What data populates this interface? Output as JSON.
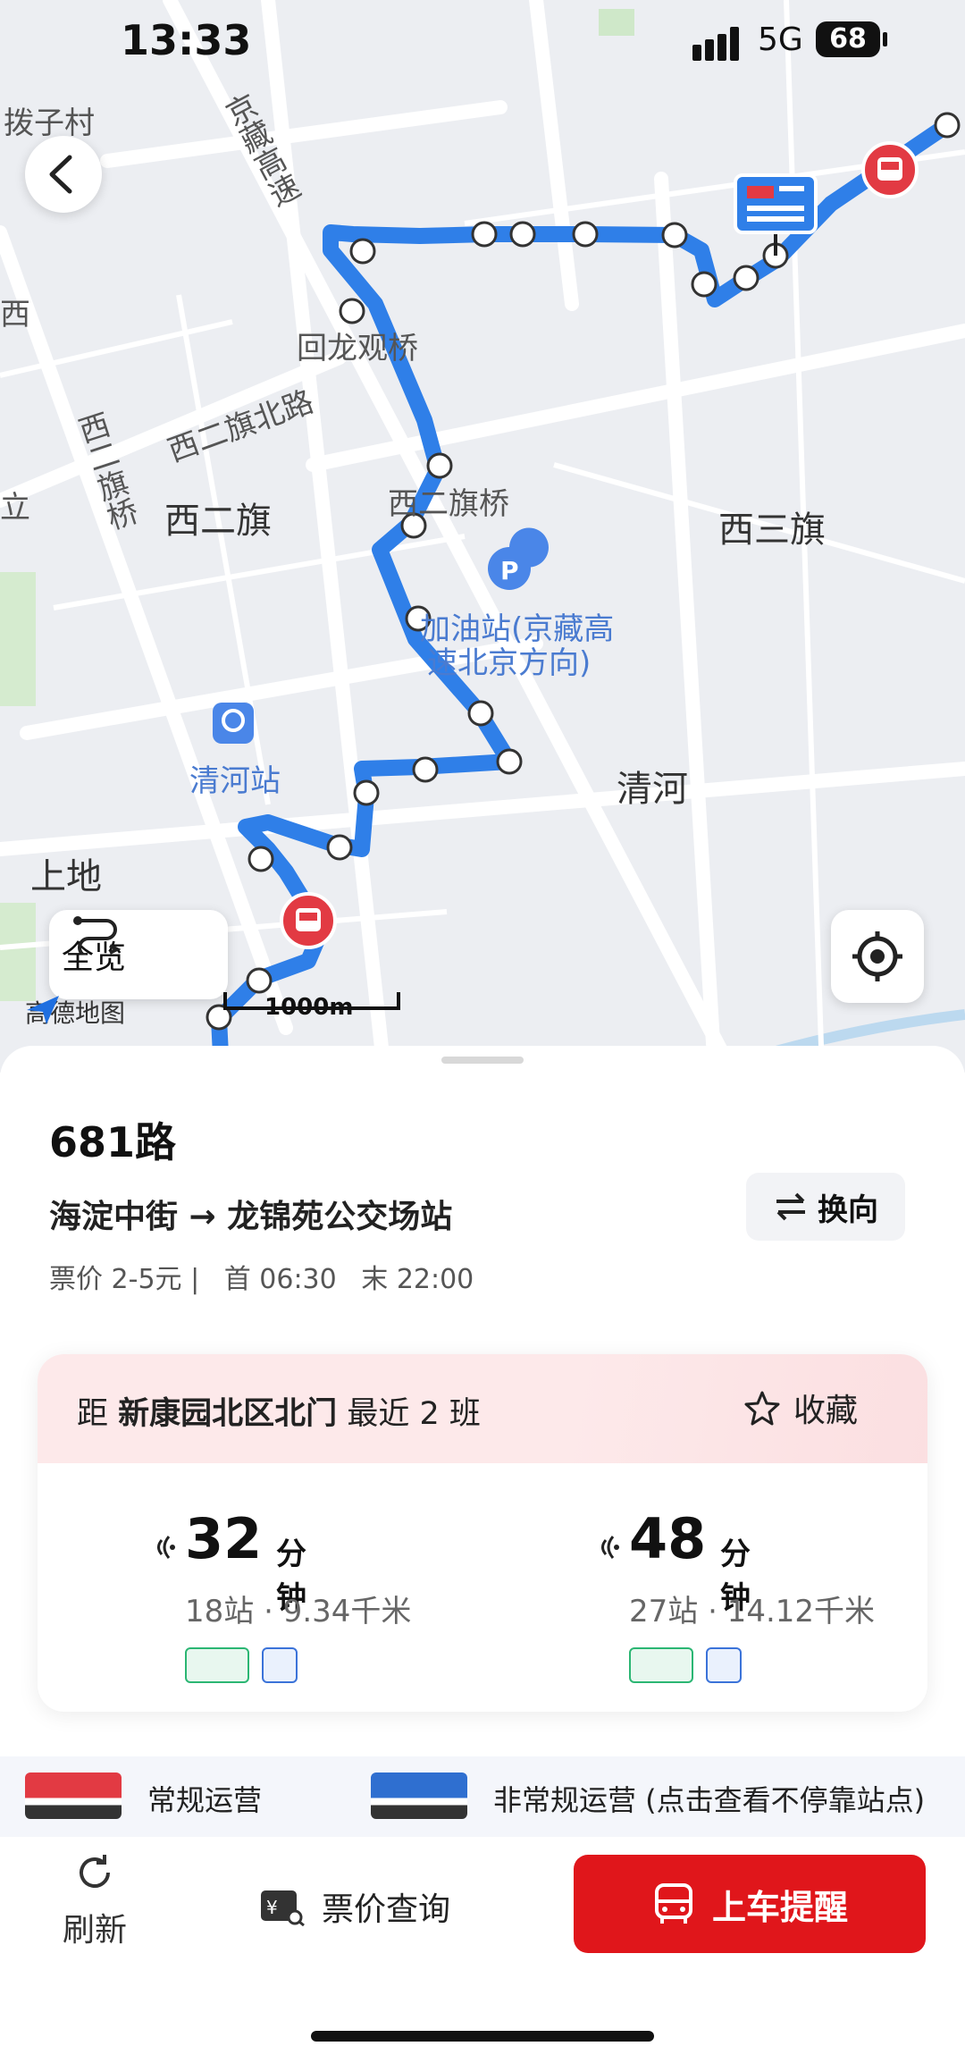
{
  "status_bar": {
    "time": "13:33",
    "network": "5G",
    "battery": "68"
  },
  "map": {
    "labels": {
      "village": "拨子村",
      "expressway": "京藏高速",
      "huilongguan_bridge": "回龙观桥",
      "xierqi_north_road": "西二旗北路",
      "xierqi_bridge": "西二旗桥",
      "xierqi_bridge_2": "西二旗桥",
      "xierqi": "西二旗",
      "xisanqi": "西三旗",
      "gas_station_1": "加油站(京藏高",
      "gas_station_2": "速北京方向)",
      "qinghe_station": "清河站",
      "qinghe": "清河",
      "shangdi": "上地",
      "xi_prefix": "西",
      "li": "立"
    },
    "overview_label": "全览",
    "scale_label": "1000m",
    "logo_text": "高德地图",
    "route_color": "#2f7fe8"
  },
  "route": {
    "name": "681路",
    "ends": "海淀中街 → 龙锦苑公交场站",
    "fare": "票价 2-5元 |",
    "first": "首 06:30",
    "last": "末 22:00",
    "reverse_label": "换向"
  },
  "arrival": {
    "prefix": "距",
    "stop": "新康园北区北门",
    "suffix": "最近 2 班",
    "favorite_label": "收藏",
    "buses": [
      {
        "minutes": "32",
        "unit": "分钟",
        "detail": "18站 · 9.34千米"
      },
      {
        "minutes": "48",
        "unit": "分钟",
        "detail": "27站 · 14.12千米"
      }
    ]
  },
  "legend": {
    "regular": "常规运营",
    "irregular": "非常规运营 (点击查看不停靠站点)"
  },
  "actions": {
    "refresh": "刷新",
    "fare_query": "票价查询",
    "remind": "上车提醒"
  },
  "colors": {
    "accent_red": "#e0161b",
    "route_blue": "#2f7fe8"
  }
}
